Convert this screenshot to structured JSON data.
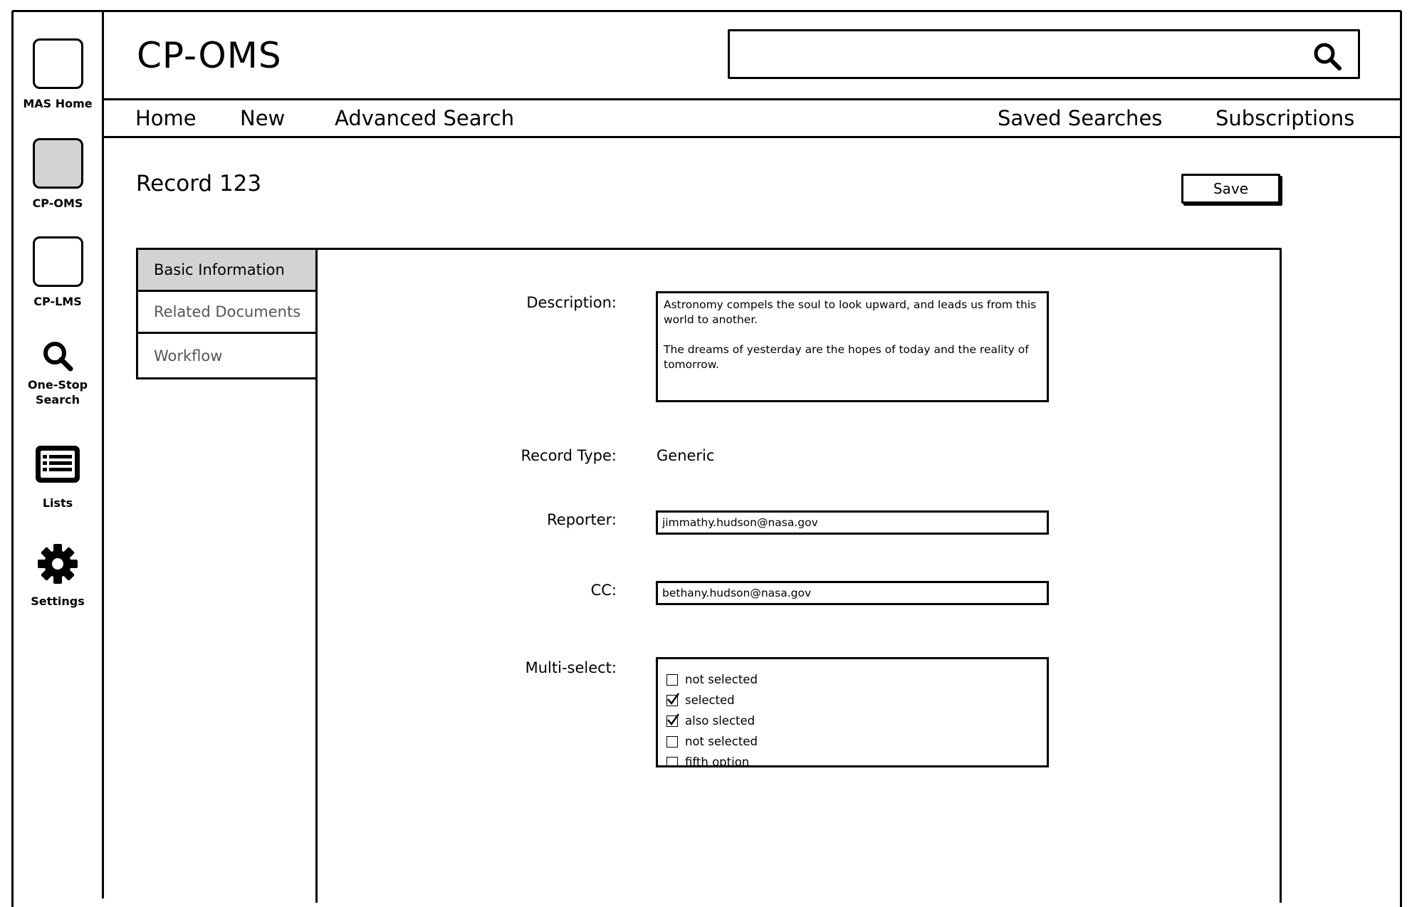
{
  "rail": {
    "items": [
      {
        "label": "MAS Home"
      },
      {
        "label": "CP-OMS"
      },
      {
        "label": "CP-LMS"
      },
      {
        "label": "One-Stop Search"
      },
      {
        "label": "Lists"
      },
      {
        "label": "Settings"
      }
    ]
  },
  "header": {
    "title": "CP-OMS",
    "search": {
      "value": "",
      "icon": "search-icon"
    }
  },
  "nav": {
    "home": "Home",
    "new": "New",
    "advanced_search": "Advanced Search",
    "saved_searches": "Saved Searches",
    "subscriptions": "Subscriptions"
  },
  "page": {
    "title": "Record 123",
    "save_label": "Save"
  },
  "tabs": [
    {
      "label": "Basic Information",
      "active": true
    },
    {
      "label": "Related Documents",
      "active": false
    },
    {
      "label": "Workflow",
      "active": false
    }
  ],
  "form": {
    "description": {
      "label": "Description:",
      "value": "Astronomy compels the soul to look upward, and leads us from this world to another.\n\nThe dreams of yesterday are the hopes of today and the reality of tomorrow."
    },
    "record_type": {
      "label": "Record Type:",
      "value": "Generic"
    },
    "reporter": {
      "label": "Reporter:",
      "value": "jimmathy.hudson@nasa.gov"
    },
    "cc": {
      "label": "CC:",
      "value": "bethany.hudson@nasa.gov"
    },
    "multi_select": {
      "label": "Multi-select:",
      "options": [
        {
          "label": "not selected",
          "checked": false
        },
        {
          "label": "selected",
          "checked": true
        },
        {
          "label": "also slected",
          "checked": true
        },
        {
          "label": "not selected",
          "checked": false
        },
        {
          "label": "fifth option",
          "checked": false
        }
      ]
    }
  },
  "colors": {
    "active_fill": "#d3d3d3",
    "stroke": "#000000",
    "inactive_tab_text": "#555555"
  }
}
